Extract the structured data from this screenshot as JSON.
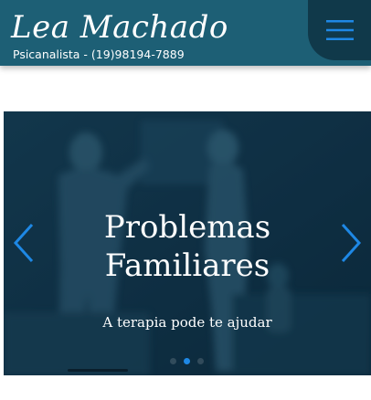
{
  "header": {
    "brand_name": "Lea Machado",
    "subtitle": "Psicanalista - (19)98194-7889",
    "menu_icon": "hamburger-menu-icon",
    "colors": {
      "header_bg": "#1d5f75",
      "menu_bg": "#10394a",
      "menu_icon": "#1e88e5"
    }
  },
  "carousel": {
    "title": "Problemas Familiares",
    "subtitle": "A terapia pode te ajudar",
    "prev_icon": "chevron-left-icon",
    "next_icon": "chevron-right-icon",
    "slide_count": 3,
    "active_slide": 2,
    "colors": {
      "arrow": "#1e88e5",
      "active_dot": "#1e88e5"
    }
  }
}
